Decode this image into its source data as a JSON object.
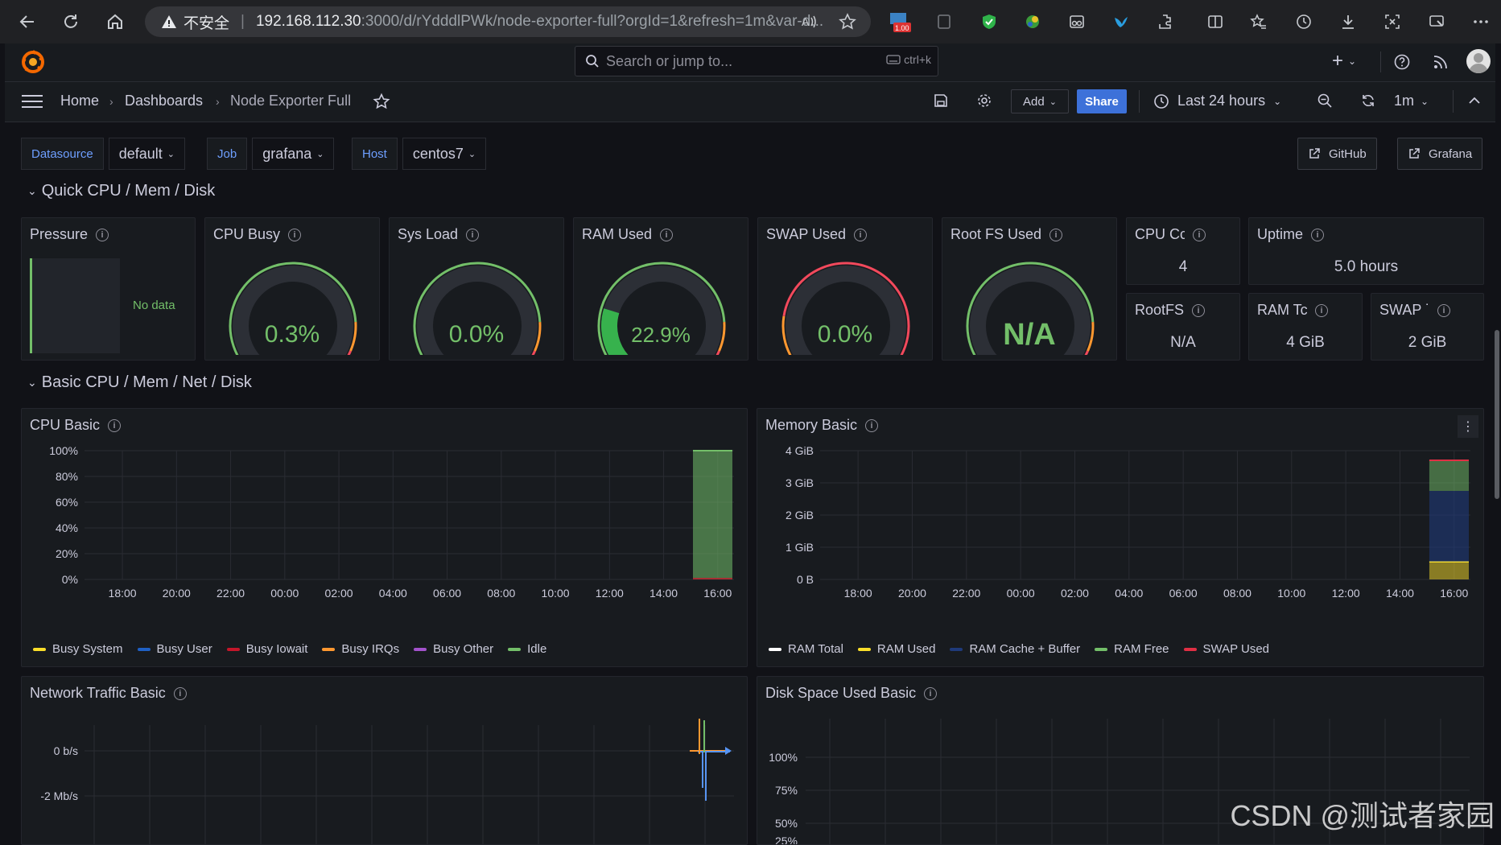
{
  "browser": {
    "insecure_label": "不安全",
    "url_host": "192.168.112.30",
    "url_rest": ":3000/d/rYdddlPWk/node-exporter-full?orgId=1&refresh=1m&var-d...",
    "ext_badge": "1.00"
  },
  "topbar": {
    "search_placeholder": "Search or jump to...",
    "shortcut": "ctrl+k",
    "new_label": "+"
  },
  "nav": {
    "crumbs": [
      "Home",
      "Dashboards",
      "Node Exporter Full"
    ],
    "add_label": "Add",
    "share_label": "Share",
    "time_range": "Last 24 hours",
    "refresh_interval": "1m"
  },
  "variables": [
    {
      "label": "Datasource",
      "value": "default"
    },
    {
      "label": "Job",
      "value": "grafana"
    },
    {
      "label": "Host",
      "value": "centos7"
    }
  ],
  "links": {
    "github": "GitHub",
    "grafana": "Grafana"
  },
  "rows": {
    "quick": "Quick CPU / Mem / Disk",
    "basic": "Basic CPU / Mem / Net / Disk"
  },
  "quick_panels": {
    "pressure": {
      "title": "Pressure",
      "nodata": "No data"
    },
    "cpu_busy": {
      "title": "CPU Busy",
      "value": "0.3%",
      "fraction": 0.003
    },
    "sys_load": {
      "title": "Sys Load",
      "value": "0.0%",
      "fraction": 0.0
    },
    "ram_used": {
      "title": "RAM Used",
      "value": "22.9%",
      "fraction": 0.229
    },
    "swap_used": {
      "title": "SWAP Used",
      "value": "0.0%",
      "fraction": 0.0
    },
    "root_fs": {
      "title": "Root FS Used",
      "value": "N/A"
    },
    "cpu_cores": {
      "title": "CPU Cc",
      "value": "4"
    },
    "uptime": {
      "title": "Uptime",
      "value": "5.0 hours"
    },
    "rootfs_total": {
      "title": "RootFS",
      "value": "N/A"
    },
    "ram_total": {
      "title": "RAM Tc",
      "value": "4 GiB"
    },
    "swap_total": {
      "title": "SWAP ˙",
      "value": "2 GiB"
    }
  },
  "chart_data": [
    {
      "title": "CPU Basic",
      "type": "area",
      "x_ticks": [
        "18:00",
        "20:00",
        "22:00",
        "00:00",
        "02:00",
        "04:00",
        "06:00",
        "08:00",
        "10:00",
        "12:00",
        "14:00",
        "16:00"
      ],
      "y_ticks": [
        "100%",
        "80%",
        "60%",
        "40%",
        "20%",
        "0%"
      ],
      "ylim": [
        0,
        100
      ],
      "legend": [
        "Busy System",
        "Busy User",
        "Busy Iowait",
        "Busy IRQs",
        "Busy Other",
        "Idle"
      ],
      "colors": [
        "#fade2a",
        "#1f60c4",
        "#8f3bb8",
        "#ff9830",
        "#b877d9",
        "#73bf69"
      ],
      "series": [
        {
          "name": "Idle",
          "start": "15:05",
          "end": "16:30",
          "values": [
            100
          ]
        }
      ]
    },
    {
      "title": "Memory Basic",
      "type": "area",
      "x_ticks": [
        "18:00",
        "20:00",
        "22:00",
        "00:00",
        "02:00",
        "04:00",
        "06:00",
        "08:00",
        "10:00",
        "12:00",
        "14:00",
        "16:00"
      ],
      "y_ticks": [
        "4 GiB",
        "3 GiB",
        "2 GiB",
        "1 GiB",
        "0 B"
      ],
      "ylim": [
        0,
        4
      ],
      "legend": [
        "RAM Total",
        "RAM Used",
        "RAM Cache + Buffer",
        "RAM Free",
        "SWAP Used"
      ],
      "colors": [
        "#ffffff",
        "#fade2a",
        "#1f3a7a",
        "#73bf69",
        "#e02f44"
      ],
      "series": [
        {
          "name": "RAM Used",
          "values": [
            0.55
          ]
        },
        {
          "name": "RAM Cache + Buffer",
          "values": [
            2.2
          ]
        },
        {
          "name": "RAM Free",
          "values": [
            0.95
          ]
        },
        {
          "name": "RAM Total",
          "values": [
            3.7
          ]
        }
      ]
    },
    {
      "title": "Network Traffic Basic",
      "type": "line",
      "y_ticks": [
        "0 b/s",
        "-2 Mb/s"
      ]
    },
    {
      "title": "Disk Space Used Basic",
      "type": "line",
      "y_ticks": [
        "100%",
        "75%",
        "50%",
        "25%"
      ]
    }
  ],
  "watermark": "CSDN @测试者家园"
}
